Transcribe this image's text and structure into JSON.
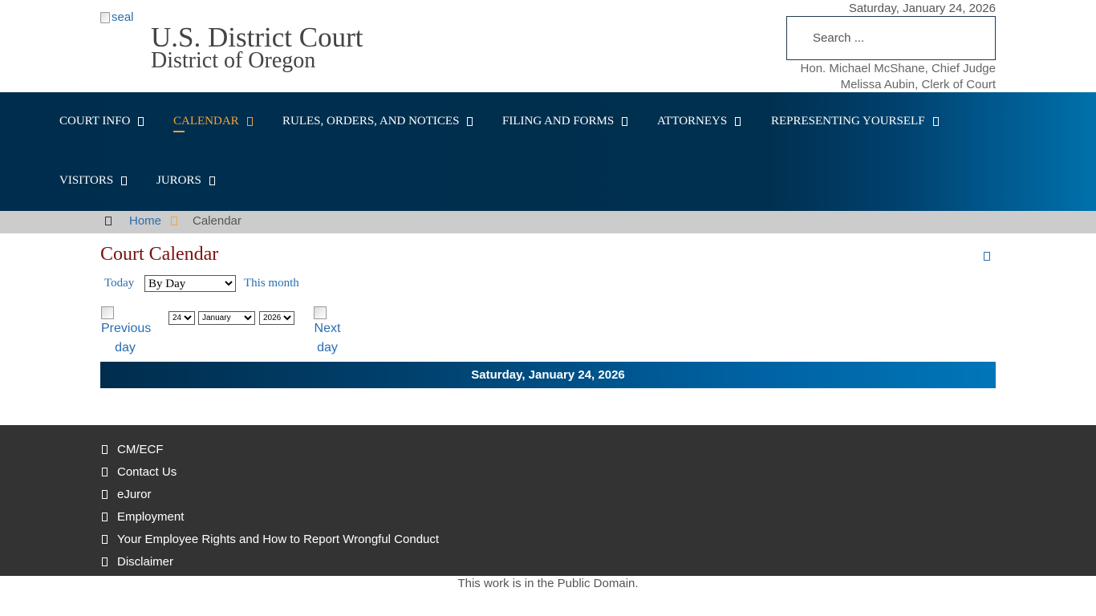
{
  "header": {
    "seal_alt": "seal",
    "title": "U.S. District Court",
    "subtitle": "District of Oregon",
    "date": "Saturday, January 24, 2026",
    "search_placeholder": "Search ...",
    "chief_judge": "Hon. Michael McShane, Chief Judge",
    "clerk": "Melissa Aubin, Clerk of Court"
  },
  "nav": {
    "items": [
      {
        "label": "COURT INFO",
        "active": false
      },
      {
        "label": "CALENDAR",
        "active": true
      },
      {
        "label": "RULES, ORDERS, AND NOTICES",
        "active": false
      },
      {
        "label": "FILING AND FORMS",
        "active": false
      },
      {
        "label": "ATTORNEYS",
        "active": false
      },
      {
        "label": "REPRESENTING YOURSELF",
        "active": false
      },
      {
        "label": "VISITORS",
        "active": false
      },
      {
        "label": "JURORS",
        "active": false
      }
    ]
  },
  "breadcrumb": {
    "home": "Home",
    "current": "Calendar"
  },
  "main": {
    "title": "Court Calendar",
    "today_link": "Today",
    "view_select": "By Day",
    "this_month_link": "This month",
    "prev_day": [
      "Previous",
      "day"
    ],
    "next_day": [
      "Next",
      "day"
    ],
    "day_value": "24",
    "month_value": "January",
    "year_value": "2026",
    "date_bar": "Saturday, January 24, 2026"
  },
  "footer": {
    "links": [
      "CM/ECF",
      "Contact Us",
      "eJuror",
      "Employment",
      "Your Employee Rights and How to Report Wrongful Conduct",
      "Disclaimer"
    ],
    "license": "This work is in the Public Domain."
  },
  "colors": {
    "nav_dark": "#002d4d",
    "nav_light": "#0071ad",
    "active": "#f0a43c",
    "title": "#7a1010",
    "link": "#2a6db0",
    "footer_bg": "#333333"
  }
}
